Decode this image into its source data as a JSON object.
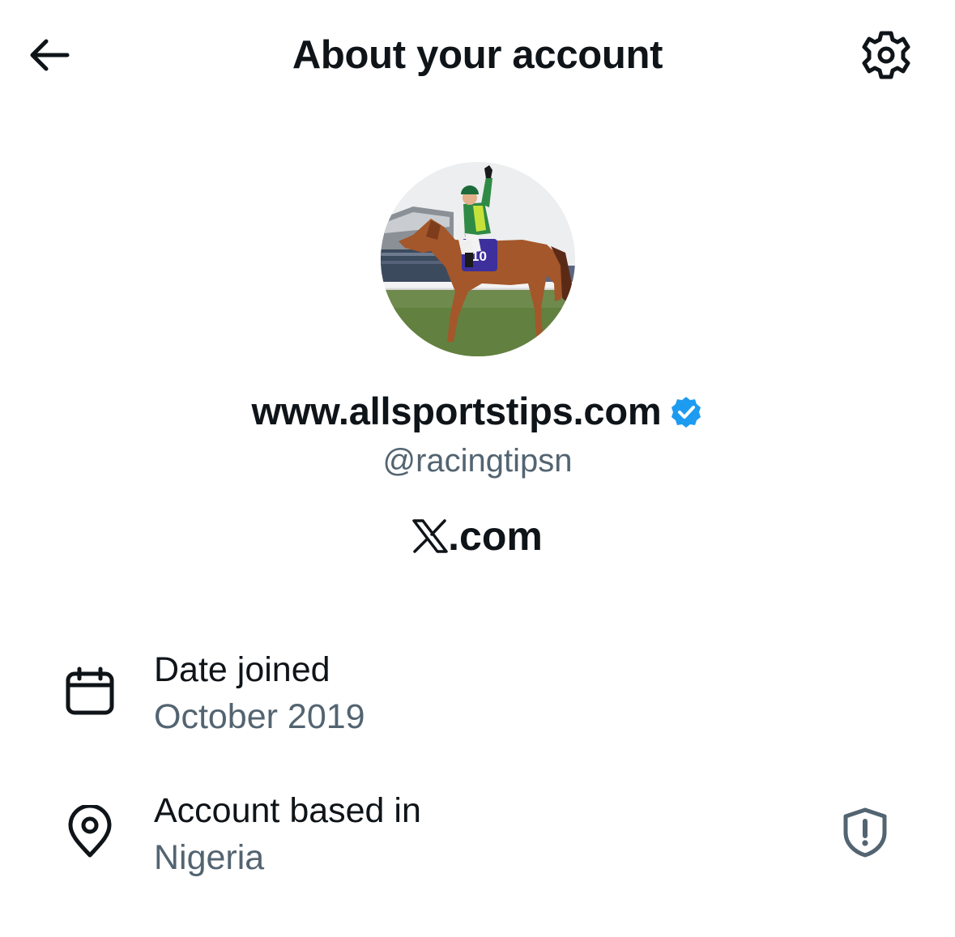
{
  "header": {
    "title": "About your account",
    "back_icon": "arrow-left-icon",
    "settings_icon": "gear-icon"
  },
  "profile": {
    "display_name": "www.allsportstips.com",
    "verified": true,
    "verified_color": "#1d9bf0",
    "handle": "@racingtipsn",
    "platform_domain": ".com",
    "avatar_content": "Jockey in green and white silks raising arm aloft on chestnut racehorse with saddle-cloth number 10",
    "saddle_cloth_number": "10"
  },
  "details": [
    {
      "icon": "calendar-icon",
      "label": "Date joined",
      "value": "October 2019"
    },
    {
      "icon": "location-pin-icon",
      "label": "Account based in",
      "value": "Nigeria",
      "action_icon": "shield-alert-icon"
    }
  ],
  "colors": {
    "primary_text": "#0f1419",
    "secondary_text": "#536471",
    "background": "#ffffff"
  }
}
